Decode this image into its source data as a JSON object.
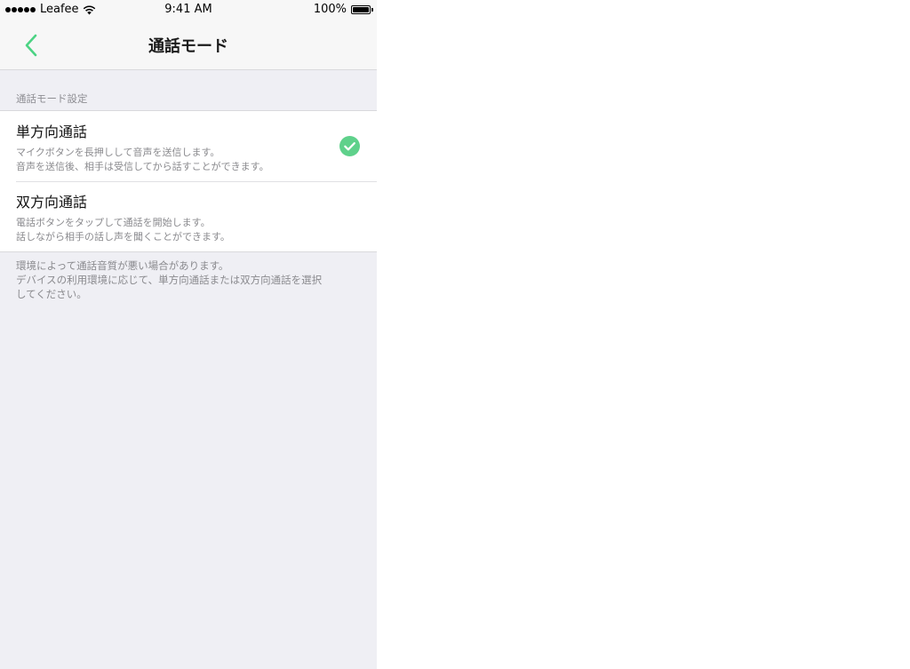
{
  "status_bar": {
    "carrier": "Leafee",
    "time": "9:41 AM",
    "battery": "100%"
  },
  "nav": {
    "title": "通話モード",
    "back_icon": "chevron-left-icon",
    "accent_color": "#4cd384"
  },
  "section": {
    "header": "通話モード設定"
  },
  "options": [
    {
      "title": "単方向通話",
      "desc_line1": "マイクボタンを長押しして音声を送信します。",
      "desc_line2": "音声を送信後、相手は受信してから話すことができます。",
      "selected": true
    },
    {
      "title": "双方向通話",
      "desc_line1": "電話ボタンをタップして通話を開始します。",
      "desc_line2": "話しながら相手の話し声を聞くことができます。",
      "selected": false
    }
  ],
  "footer": {
    "line1": "環境によって通話音質が悪い場合があります。",
    "line2": "デバイスの利用環境に応じて、単方向通話または双方向通話を選択",
    "line3": "してください。"
  },
  "colors": {
    "check": "#5fd18b",
    "background": "#efeff4"
  }
}
